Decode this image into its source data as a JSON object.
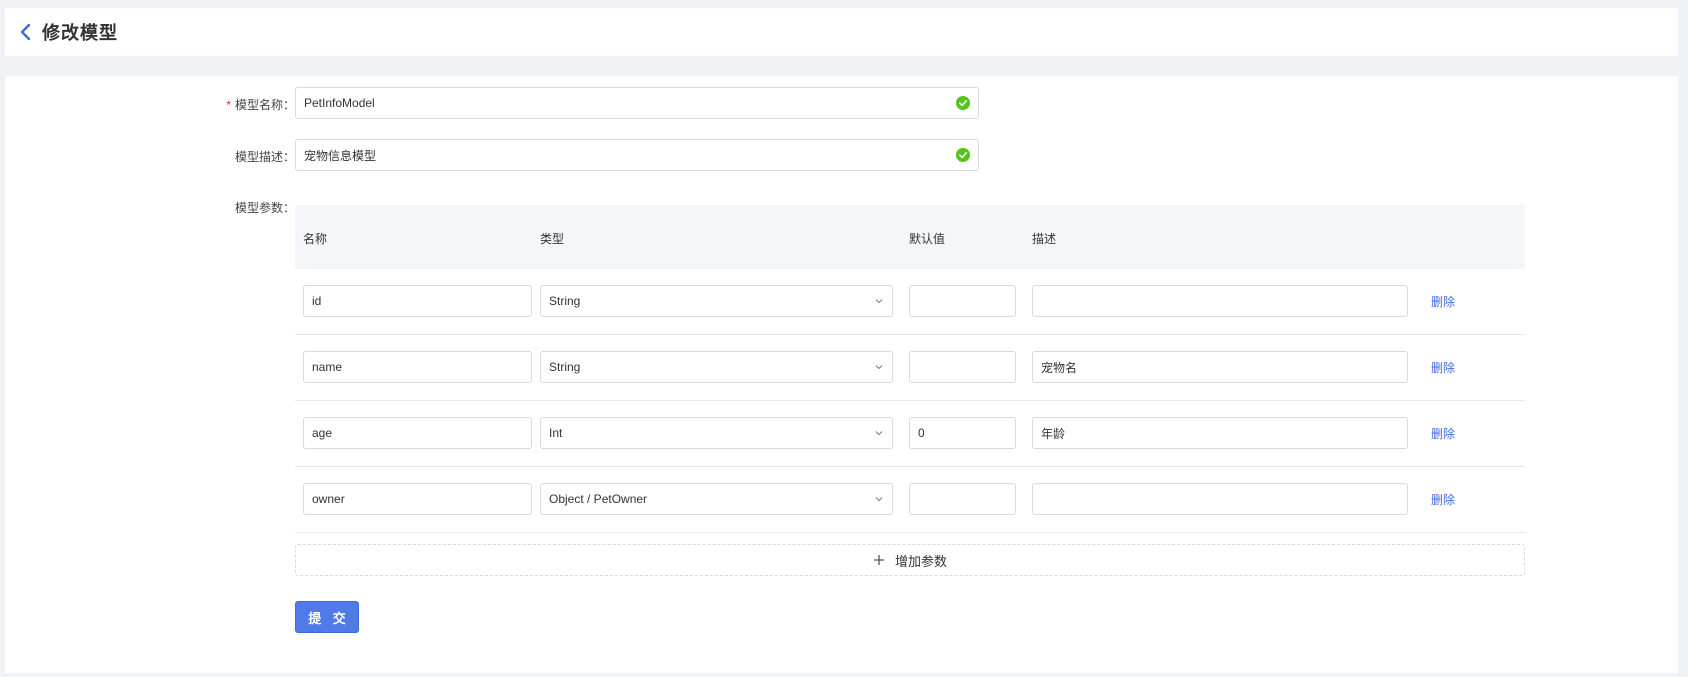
{
  "header": {
    "title": "修改模型"
  },
  "form": {
    "name": {
      "label": "模型名称：",
      "required_mark": "*",
      "value": "PetInfoModel"
    },
    "desc": {
      "label": "模型描述：",
      "value": "宠物信息模型"
    },
    "params": {
      "label": "模型参数：",
      "columns": [
        "名称",
        "类型",
        "默认值",
        "描述"
      ],
      "rows": [
        {
          "name": "id",
          "type": "String",
          "default": "",
          "desc": "",
          "action": "删除"
        },
        {
          "name": "name",
          "type": "String",
          "default": "",
          "desc": "宠物名",
          "action": "删除"
        },
        {
          "name": "age",
          "type": "Int",
          "default": "0",
          "desc": "年龄",
          "action": "删除"
        },
        {
          "name": "owner",
          "type": "Object / PetOwner",
          "default": "",
          "desc": "",
          "action": "删除"
        }
      ],
      "add_label": "增加参数"
    },
    "submit_label": "提 交"
  },
  "colors": {
    "accent": "#4f7ae8",
    "link": "#3f6bd8",
    "success": "#52c41a",
    "required": "#f5222d"
  },
  "icons": [
    "chevron-left-icon",
    "check-circle-icon",
    "chevron-down-icon",
    "plus-icon"
  ]
}
